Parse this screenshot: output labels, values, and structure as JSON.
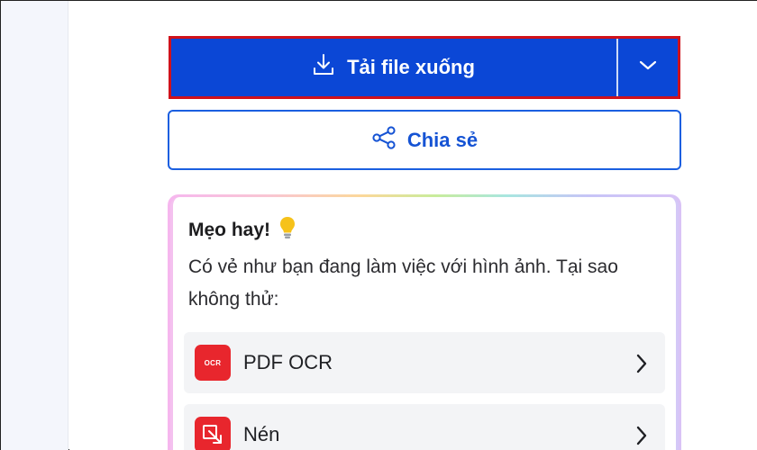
{
  "download": {
    "label": "Tải file xuống",
    "icon": "download-icon",
    "caret_icon": "chevron-down-icon",
    "bg_color": "#0b47d6",
    "highlight_color": "#d0121b"
  },
  "share": {
    "label": "Chia sẻ",
    "icon": "share-icon",
    "color": "#1553d4"
  },
  "tip": {
    "title": "Mẹo hay!",
    "icon": "lightbulb-icon",
    "text": "Có vẻ như bạn đang làm việc với hình ảnh. Tại sao không thử:",
    "tools": [
      {
        "label": "PDF OCR",
        "icon": "ocr-icon",
        "icon_text": "OCR",
        "icon_color": "#e8262d"
      },
      {
        "label": "Nén",
        "icon": "compress-icon",
        "icon_color": "#e8262d"
      }
    ]
  }
}
